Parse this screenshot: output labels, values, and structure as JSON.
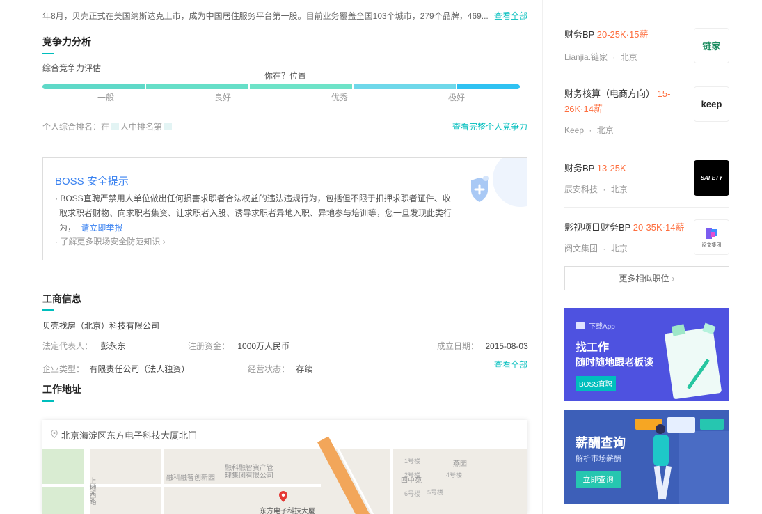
{
  "company_intro": {
    "text": "年8月，贝壳正式在美国纳斯达克上市，成为中国居住服务平台第一股。目前业务覆盖全国103个城市，279个品牌，469...",
    "view_all": "查看全部"
  },
  "competition": {
    "title": "竞争力分析",
    "subtitle": "综合竞争力评估",
    "you_here": "你在？位置",
    "levels": [
      "一般",
      "良好",
      "优秀",
      "极好"
    ],
    "rank_prefix": "个人综合排名：在",
    "rank_mid": "人中排名第",
    "view_full": "查看完整个人竞争力"
  },
  "safety": {
    "title": "BOSS 安全提示",
    "body": "BOSS直聘严禁用人单位做出任何损害求职者合法权益的违法违规行为，包括但不限于扣押求职者证件、收取求职者财物、向求职者集资、让求职者入股、诱导求职者异地入职、异地参与培训等，您一旦发现此类行为，",
    "report_link": "请立即举报",
    "more_link": "了解更多职场安全防范知识"
  },
  "business": {
    "title": "工商信息",
    "company_name": "贝壳找房（北京）科技有限公司",
    "legal_rep_label": "法定代表人：",
    "legal_rep": "彭永东",
    "capital_label": "注册资金：",
    "capital": "1000万人民币",
    "founded_label": "成立日期：",
    "founded": "2015-08-03",
    "type_label": "企业类型：",
    "type": "有限责任公司（法人独资）",
    "status_label": "经营状态：",
    "status": "存续",
    "view_all": "查看全部"
  },
  "address": {
    "title": "工作地址",
    "text": "北京海淀区东方电子科技大厦北门",
    "map_labels": [
      "融科融智创新园",
      "融科融智资产管理集团有限公司",
      "东方电子科技大厦",
      "上地西路",
      "1号楼",
      "2号楼",
      "燕园",
      "四中苑",
      "4号楼",
      "6号楼",
      "5号楼"
    ]
  },
  "similar_jobs": [
    {
      "title": "财务BP",
      "salary": "20-25K·15薪",
      "company": "Lianjia.链家",
      "city": "北京",
      "logo": "链家"
    },
    {
      "title": "财务核算（电商方向）",
      "salary": "15-26K·14薪",
      "company": "Keep",
      "city": "北京",
      "logo": "keep"
    },
    {
      "title": "财务BP",
      "salary": "13-25K",
      "company": "辰安科技",
      "city": "北京",
      "logo": "SAFETY"
    },
    {
      "title": "影视项目财务BP",
      "salary": "20-35K·14薪",
      "company": "阅文集团",
      "city": "北京",
      "logo": "阅文集团"
    }
  ],
  "more_jobs": "更多相似职位",
  "ad1": {
    "tag": "下载App",
    "line1": "找工作",
    "line2": "随时随地跟老板谈",
    "badge": "BOSS直聘"
  },
  "ad2": {
    "line1": "薪酬查询",
    "line2": "解析市场薪酬",
    "button": "立即查询"
  },
  "colors": {
    "accent": "#00bebd",
    "salary": "#fe6e3e",
    "link": "#3a82f0",
    "ad1_bg": "#4e52e0",
    "ad2_bg": "#3d5fb8"
  }
}
